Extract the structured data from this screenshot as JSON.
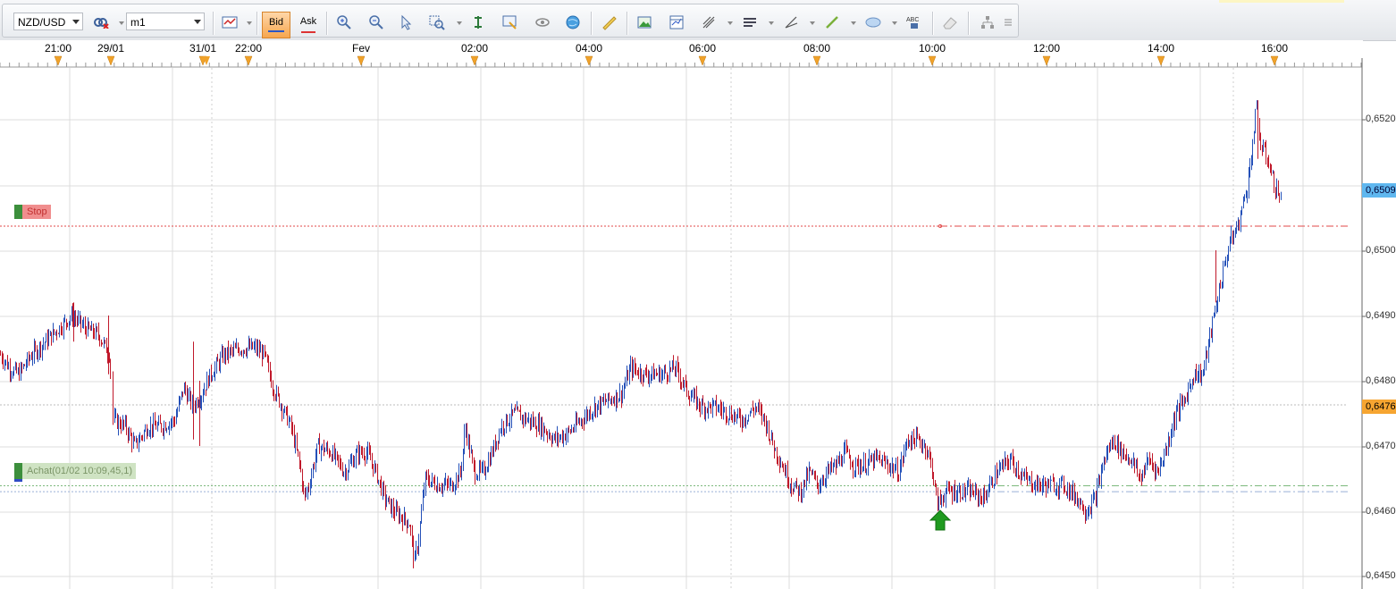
{
  "toolbar": {
    "symbol": "NZD/USD",
    "timeframe": "m1",
    "bid_label": "Bid",
    "ask_label": "Ask",
    "icons": [
      "symbol-link-icon",
      "chart-type-icon",
      "zoom-in-icon",
      "zoom-out-icon",
      "pointer-icon",
      "zoom-area-icon",
      "cursor-icon",
      "export-icon",
      "refresh-icon",
      "globe-icon",
      "ruler-icon",
      "image-icon",
      "template-icon",
      "indicators-icon",
      "bars-icon",
      "trendline-icon",
      "line-icon",
      "ellipse-icon",
      "text-abc-icon",
      "eraser-icon",
      "tree-icon",
      "menu-icon"
    ]
  },
  "time_axis": {
    "labels": [
      {
        "text": "21:00"
      },
      {
        "text": "29/01"
      },
      {
        "text": "31/01"
      },
      {
        "text": "22:00"
      },
      {
        "text": "Fev"
      },
      {
        "text": "02:00"
      },
      {
        "text": "04:00"
      },
      {
        "text": "06:00"
      },
      {
        "text": "08:00"
      },
      {
        "text": "10:00"
      },
      {
        "text": "12:00"
      },
      {
        "text": "14:00"
      },
      {
        "text": "16:00"
      }
    ]
  },
  "price_axis": {
    "labels": [
      "0,6520",
      "0,6500",
      "0,6490",
      "0,6480",
      "0,6470",
      "0,6460",
      "0,6450"
    ],
    "current_price": "0,6509",
    "ref_price": "0,6476"
  },
  "stop_label": "Stop",
  "order_label": "Achat(01/02 10:09,45,1)",
  "colors": {
    "up": "#2450b8",
    "down": "#c0182a",
    "stop_line": "#e04848",
    "order_line": "#7cb97c",
    "grid": "#dcdcdc",
    "current_price_bg": "#5fb7ef",
    "ref_price_bg": "#f6a531",
    "arrow": "#1f9a1f"
  }
}
